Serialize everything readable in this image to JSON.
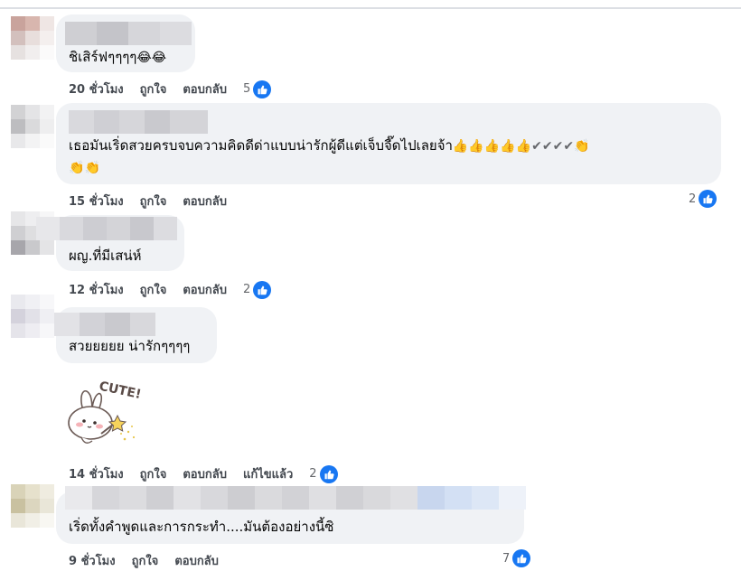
{
  "comments": [
    {
      "text": "ชิเสิร์ฟๆๆๆๆ",
      "emojis": [
        "😂",
        "😂"
      ],
      "time": "20 ชั่วโมง",
      "like": "ถูกใจ",
      "reply": "ตอบกลับ",
      "reactions": "5"
    },
    {
      "text_line1": "เธอมันเริ่ดสวยครบจบความคิดดีด่าแบบน่ารักผู้ดีแต่เจ็บจี๊ดไปเลยจ้า",
      "emojis_line1": [
        "👍",
        "👍",
        "👍",
        "👍",
        "👍",
        "✔",
        "✔",
        "✔",
        "✔",
        "👏"
      ],
      "emojis_line2": [
        "👏",
        "👏"
      ],
      "time": "15 ชั่วโมง",
      "like": "ถูกใจ",
      "reply": "ตอบกลับ",
      "reactions": "2"
    },
    {
      "text": "ผญ.ที่มีเสน่ห์",
      "time": "12 ชั่วโมง",
      "like": "ถูกใจ",
      "reply": "ตอบกลับ",
      "reactions": "2"
    },
    {
      "text": "สวยยยยย น่ารักๆๆๆๆ",
      "sticker_text": "CUTE!",
      "time": "14 ชั่วโมง",
      "like": "ถูกใจ",
      "reply": "ตอบกลับ",
      "edited": "แก้ไขแล้ว",
      "reactions": "2"
    },
    {
      "text": "เริ่ดทั้งคำพูดและการกระทำ....มันต้องอย่างนี้ซิ",
      "time": "9 ชั่วโมง",
      "like": "ถูกใจ",
      "reply": "ตอบกลับ",
      "reactions": "7"
    }
  ],
  "icons": {
    "reaction": "like-thumb-icon",
    "sticker": "bunny-cute-sticker"
  },
  "colors": {
    "bubble": "#f0f2f5",
    "like_blue": "#1877f2",
    "action_text": "#444950",
    "meta_text": "#65676b"
  }
}
